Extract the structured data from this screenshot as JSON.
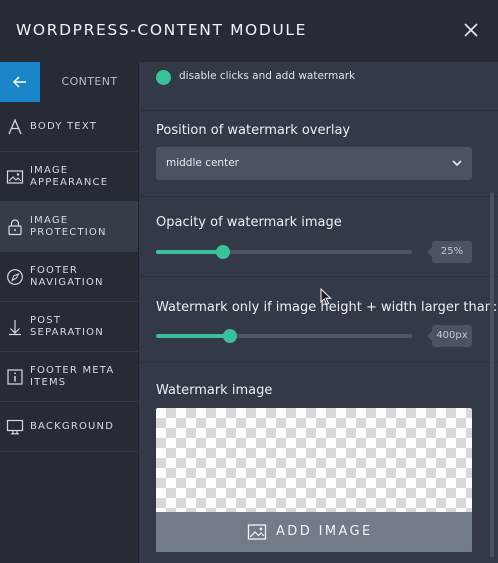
{
  "header": {
    "title": "WORDPRESS-CONTENT MODULE",
    "close_icon": "close-icon"
  },
  "sidebar": {
    "back_icon": "arrow-left-icon",
    "heading": "CONTENT",
    "items": [
      {
        "label": "BODY TEXT",
        "icon": "letter-a-icon",
        "active": false
      },
      {
        "label": "IMAGE APPEARANCE",
        "icon": "image-icon",
        "active": false
      },
      {
        "label": "IMAGE PROTECTION",
        "icon": "lock-icon",
        "active": true
      },
      {
        "label": "FOOTER NAVIGATION",
        "icon": "compass-icon",
        "active": false
      },
      {
        "label": "POST SEPARATION",
        "icon": "arrow-down-icon",
        "active": false
      },
      {
        "label": "FOOTER META ITEMS",
        "icon": "info-icon",
        "active": false
      },
      {
        "label": "BACKGROUND",
        "icon": "monitor-icon",
        "active": false
      }
    ]
  },
  "main": {
    "toggle": {
      "label": "disable clicks and add watermark",
      "on": true
    },
    "position": {
      "label": "Position of watermark overlay",
      "value": "middle center"
    },
    "opacity": {
      "label": "Opacity of watermark image",
      "value_text": "25%",
      "fraction": 0.26
    },
    "min_size": {
      "label": "Watermark only if image height + width larger than:",
      "value_text": "400px",
      "fraction": 0.29
    },
    "image": {
      "label": "Watermark image",
      "button_label": "ADD IMAGE",
      "button_icon": "image-icon"
    }
  },
  "colors": {
    "accent": "#39c19a",
    "back_button": "#1a86c8",
    "panel": "#333946",
    "sidebar": "#262b35"
  }
}
